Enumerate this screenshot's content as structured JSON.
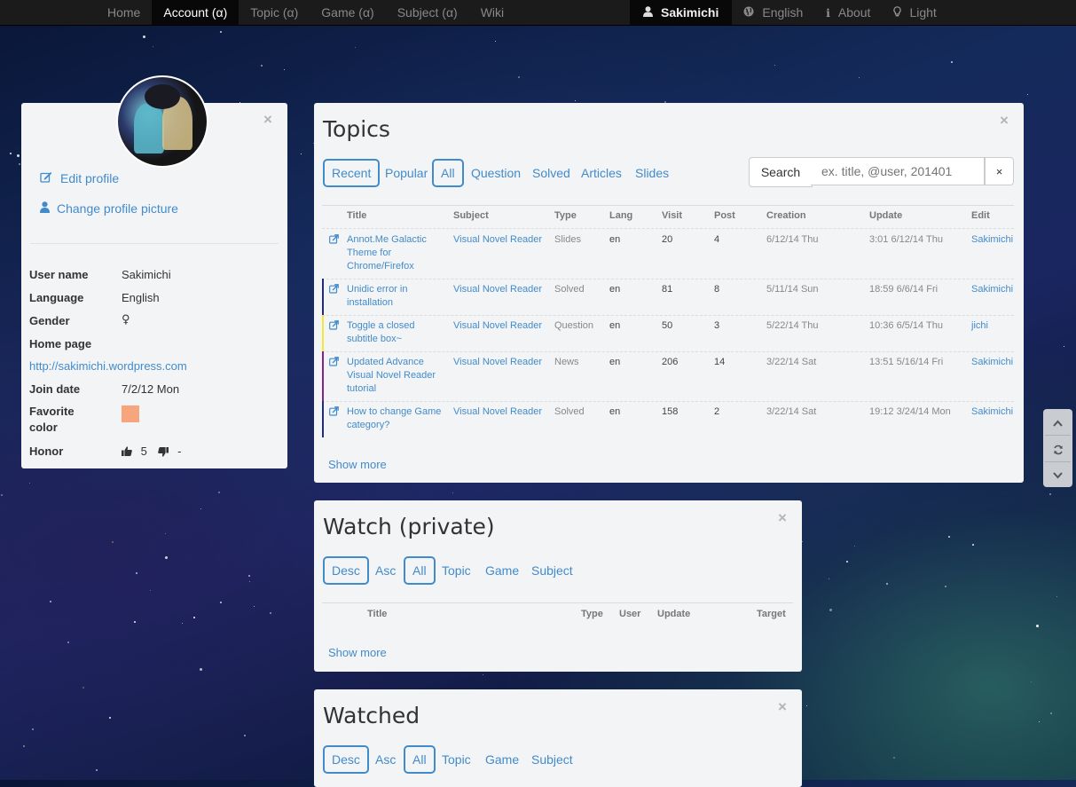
{
  "nav": {
    "left": [
      "Home",
      "Account (α)",
      "Topic (α)",
      "Game (α)",
      "Subject (α)",
      "Wiki"
    ],
    "user": "Sakimichi",
    "language": "English",
    "about": "About",
    "theme": "Light"
  },
  "profile": {
    "edit_profile": "Edit profile",
    "change_picture": "Change profile picture",
    "fields": {
      "username_label": "User name",
      "username": "Sakimichi",
      "language_label": "Language",
      "language": "English",
      "gender_label": "Gender",
      "gender": "♀",
      "homepage_label": "Home page",
      "homepage": "http://sakimichi.wordpress.com",
      "joindate_label": "Join date",
      "joindate": "7/2/12 Mon",
      "favcolor_label": "Favorite color",
      "favcolor": "#f7a57c",
      "honor_label": "Honor",
      "honor_up": "5",
      "honor_down": "-"
    }
  },
  "topics": {
    "title": "Topics",
    "sort_tabs": [
      "Recent",
      "Popular"
    ],
    "filter_tabs": [
      "All",
      "Question",
      "Solved",
      "Articles",
      "Slides"
    ],
    "search_label": "Search",
    "search_placeholder": "ex. title, @user, 201401",
    "search_clear": "×",
    "columns": [
      "Title",
      "Subject",
      "Type",
      "Lang",
      "Visit",
      "Post",
      "Creation",
      "Update",
      "Edit"
    ],
    "rows": [
      {
        "title": "Annot.Me Galactic Theme for Chrome/Firefox",
        "subject": "Visual Novel Reader",
        "type": "Slides",
        "lang": "en",
        "visit": "20",
        "post": "4",
        "creation": "6/12/14 Thu",
        "update": "3:01 6/12/14 Thu",
        "edit": "Sakimichi",
        "bar": ""
      },
      {
        "title": "Unidic error in installation",
        "subject": "Visual Novel Reader",
        "type": "Solved",
        "lang": "en",
        "visit": "81",
        "post": "8",
        "creation": "5/11/14 Sun",
        "update": "18:59 6/6/14 Fri",
        "edit": "Sakimichi",
        "bar": "#1f2a8f"
      },
      {
        "title": "Toggle a closed subtitle box~",
        "subject": "Visual Novel Reader",
        "type": "Question",
        "lang": "en",
        "visit": "50",
        "post": "3",
        "creation": "5/22/14 Thu",
        "update": "10:36 6/5/14 Thu",
        "edit": "jichi",
        "bar": "#f5e63a"
      },
      {
        "title": "Updated Advance Visual Novel Reader tutorial",
        "subject": "Visual Novel Reader",
        "type": "News",
        "lang": "en",
        "visit": "206",
        "post": "14",
        "creation": "3/22/14 Sat",
        "update": "13:51 5/16/14 Fri",
        "edit": "Sakimichi",
        "bar": "#8a1f8f"
      },
      {
        "title": "How to change Game category?",
        "subject": "Visual Novel Reader",
        "type": "Solved",
        "lang": "en",
        "visit": "158",
        "post": "2",
        "creation": "3/22/14 Sat",
        "update": "19:12 3/24/14 Mon",
        "edit": "Sakimichi",
        "bar": "#1f2a8f"
      }
    ],
    "show_more": "Show more"
  },
  "watch": {
    "title": "Watch (private)",
    "sort_tabs": [
      "Desc",
      "Asc"
    ],
    "filter_tabs": [
      "All",
      "Topic",
      "Game",
      "Subject"
    ],
    "columns": [
      "Title",
      "Type",
      "User",
      "Update",
      "Target"
    ],
    "show_more": "Show more"
  },
  "watched": {
    "title": "Watched",
    "sort_tabs": [
      "Desc",
      "Asc"
    ],
    "filter_tabs": [
      "All",
      "Topic",
      "Game",
      "Subject"
    ]
  },
  "close_symbol": "×",
  "colors": {
    "link": "#428bca",
    "nav_bg": "#1b1b1b",
    "panel_bg": "#f3f4f6"
  }
}
